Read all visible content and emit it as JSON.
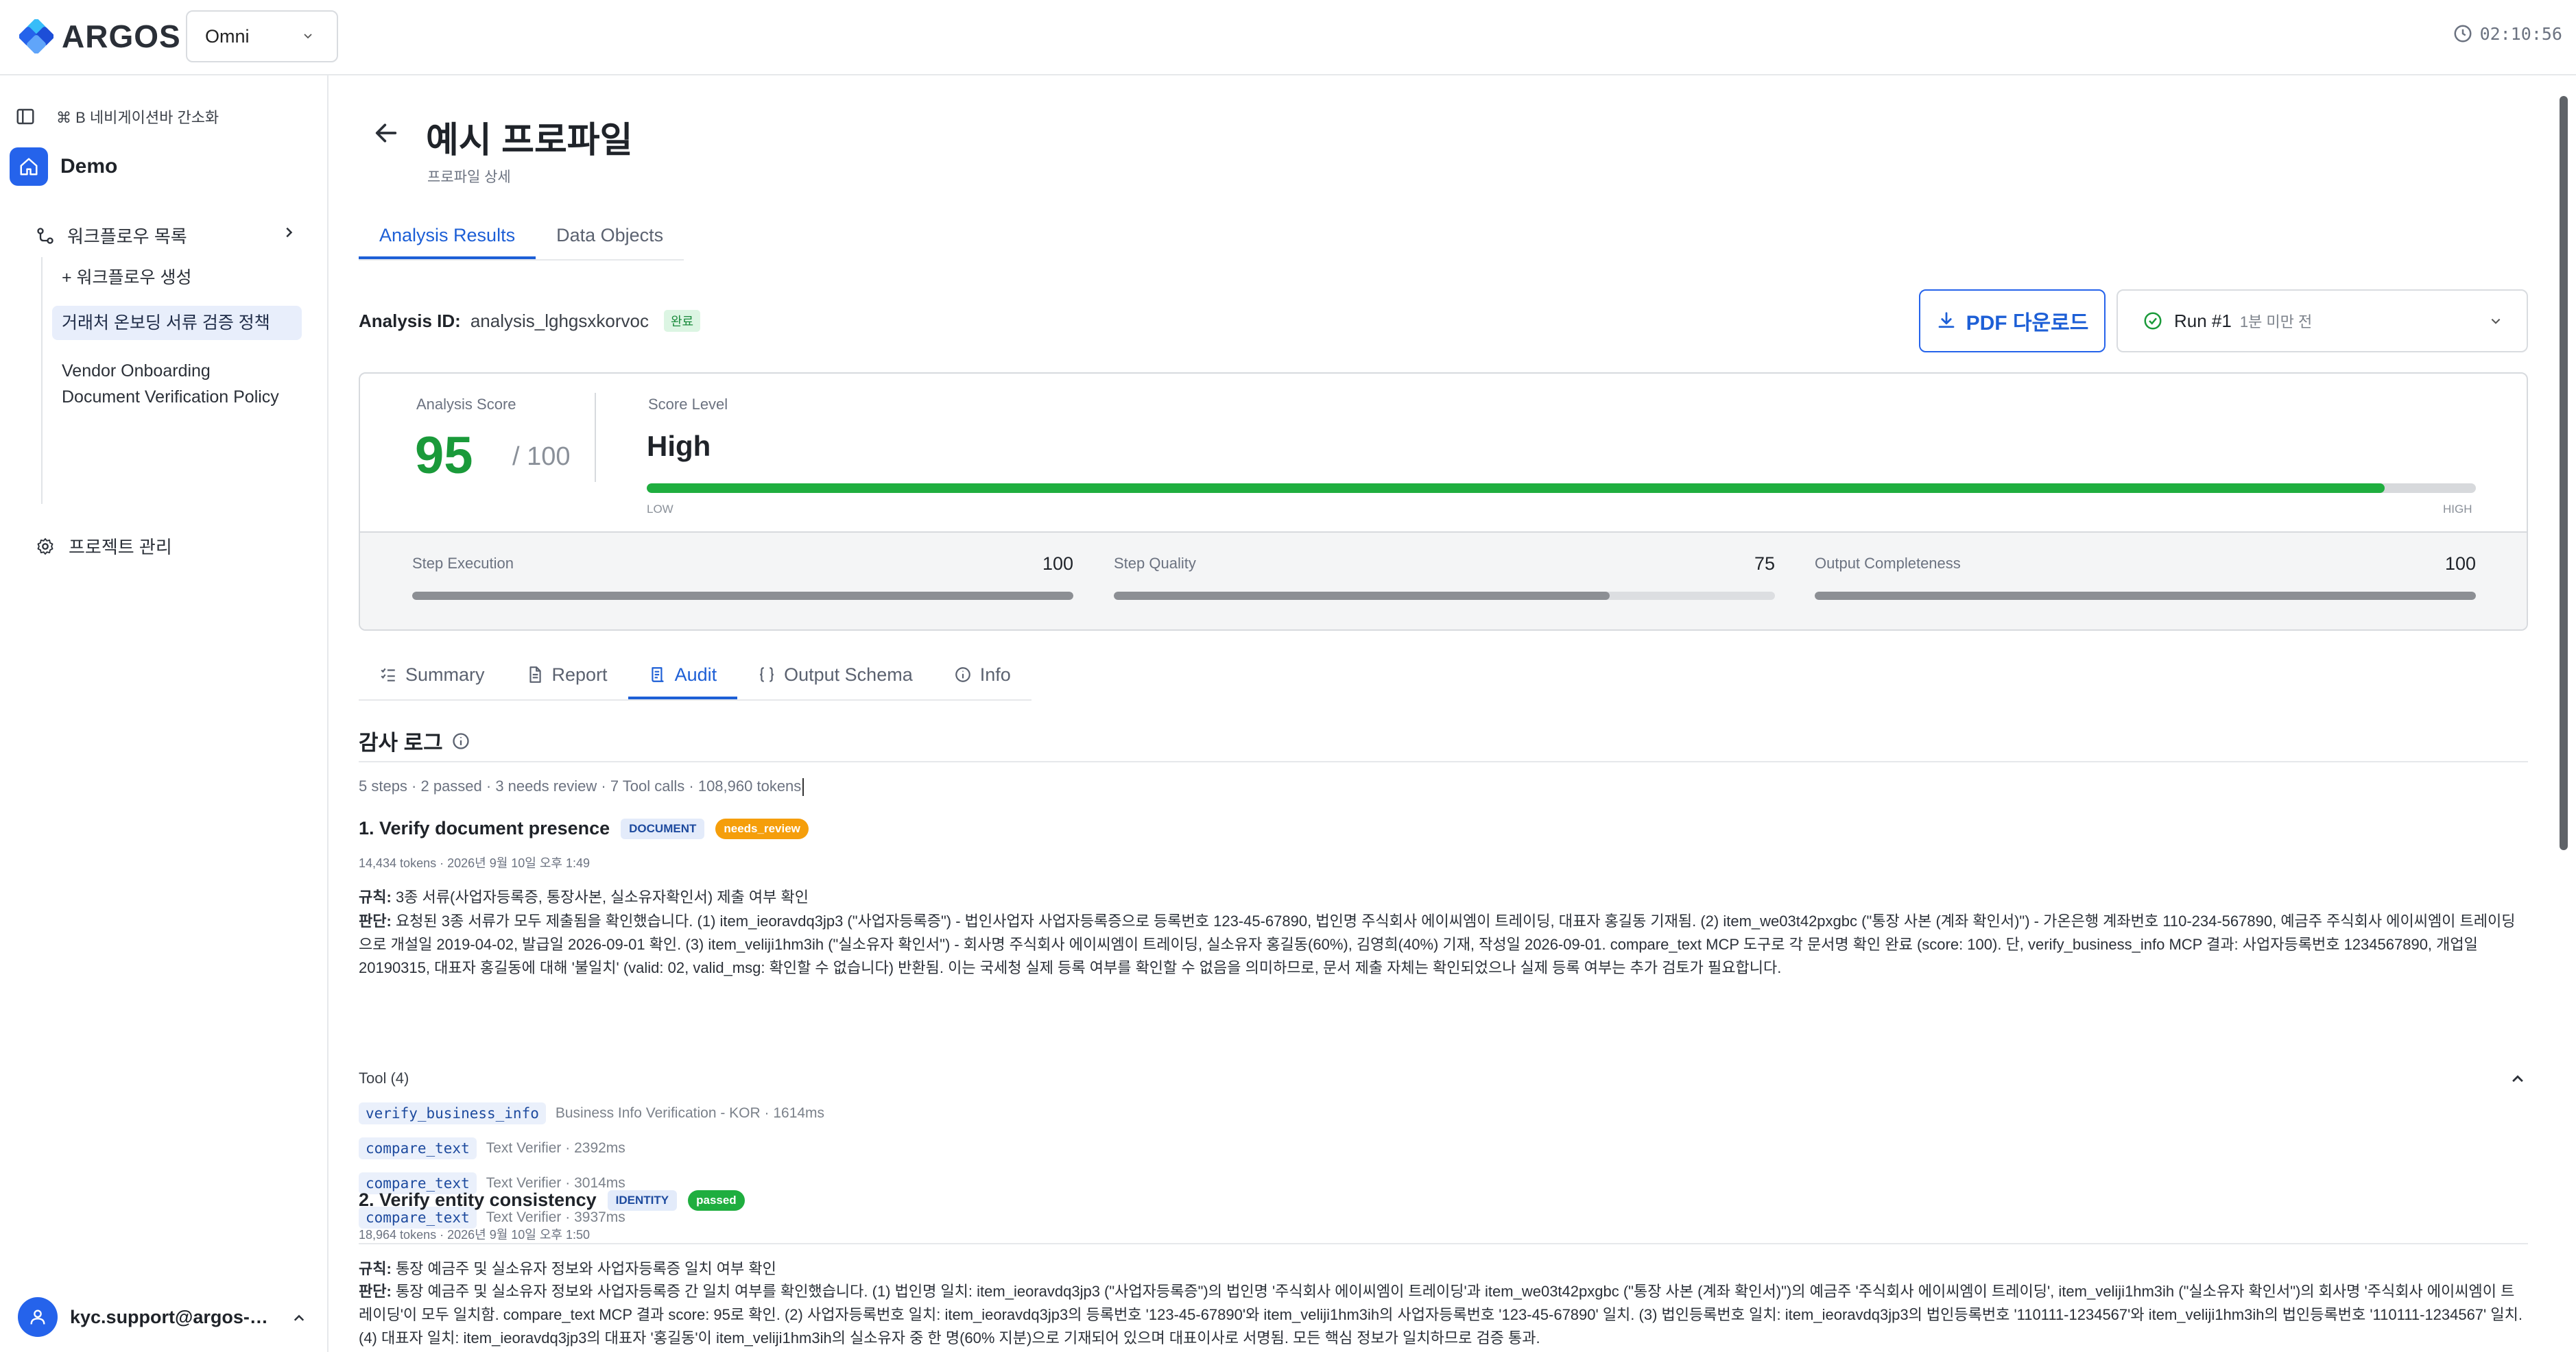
{
  "app": {
    "logo_text": "ARGOS",
    "workspace": "Omni",
    "clock": "02:10:56"
  },
  "sidebar": {
    "collapse_hint": "⌘ B 네비게이션바 간소화",
    "project": "Demo",
    "workflow_list": "워크플로우 목록",
    "create_workflow": "+ 워크플로우 생성",
    "workflows": [
      "거래처 온보딩 서류 검증 정책",
      "Vendor Onboarding Document Verification Policy"
    ],
    "project_manage": "프로젝트 관리",
    "user_email": "kyc.support@argos-s..."
  },
  "page": {
    "title": "예시 프로파일",
    "subtitle": "프로파일 상세",
    "tabs": [
      "Analysis Results",
      "Data Objects"
    ]
  },
  "analysis": {
    "id_label": "Analysis ID:",
    "id_value": "analysis_lghgsxkorvoc",
    "status": "완료",
    "pdf_button": "PDF 다운로드",
    "run_label": "Run #1",
    "run_time": "1분 미만 전"
  },
  "score": {
    "label": "Analysis Score",
    "value": "95",
    "max": "/ 100",
    "level_label": "Score Level",
    "level": "High",
    "level_fraction": 0.95,
    "low": "LOW",
    "high": "HIGH",
    "metrics": [
      {
        "name": "Step Execution",
        "value": "100",
        "fraction": 1.0
      },
      {
        "name": "Step Quality",
        "value": "75",
        "fraction": 0.75
      },
      {
        "name": "Output Completeness",
        "value": "100",
        "fraction": 1.0
      }
    ]
  },
  "result_tabs": [
    "Summary",
    "Report",
    "Audit",
    "Output Schema",
    "Info"
  ],
  "audit": {
    "title": "감사 로그",
    "meta": "5 steps · 2 passed · 3 needs review · 7 Tool calls · 108,960 tokens",
    "steps": [
      {
        "title": "1. Verify document presence",
        "tag": "DOCUMENT",
        "status": "needs_review",
        "meta": "14,434 tokens · 2026년 9월 10일 오후 1:49",
        "rule_label": "규칙:",
        "rule": "3종 서류(사업자등록증, 통장사본, 실소유자확인서) 제출 여부 확인",
        "judge_label": "판단:",
        "judge": "요청된 3종 서류가 모두 제출됨을 확인했습니다. (1) item_ieoravdq3jp3 (\"사업자등록증\") - 법인사업자 사업자등록증으로 등록번호 123-45-67890, 법인명 주식회사 에이씨엠이 트레이딩, 대표자 홍길동 기재됨. (2) item_we03t42pxgbc (\"통장 사본 (계좌 확인서)\") - 가온은행 계좌번호 110-234-567890, 예금주 주식회사 에이씨엠이 트레이딩으로 개설일 2019-04-02, 발급일 2026-09-01 확인. (3) item_veliji1hm3ih (\"실소유자 확인서\") - 회사명 주식회사 에이씨엠이 트레이딩, 실소유자 홍길동(60%), 김영희(40%) 기재, 작성일 2026-09-01. compare_text MCP 도구로 각 문서명 확인 완료 (score: 100). 단, verify_business_info MCP 결과: 사업자등록번호 1234567890, 개업일 20190315, 대표자 홍길동에 대해 '불일치' (valid: 02, valid_msg: 확인할 수 없습니다) 반환됨. 이는 국세청 실제 등록 여부를 확인할 수 없음을 의미하므로, 문서 제출 자체는 확인되었으나 실제 등록 여부는 추가 검토가 필요합니다.",
        "tool_head": "Tool (4)",
        "tools": [
          {
            "name": "verify_business_info",
            "desc": "Business Info Verification - KOR · 1614ms"
          },
          {
            "name": "compare_text",
            "desc": "Text Verifier · 2392ms"
          },
          {
            "name": "compare_text",
            "desc": "Text Verifier · 3014ms"
          },
          {
            "name": "compare_text",
            "desc": "Text Verifier · 3937ms"
          }
        ]
      },
      {
        "title": "2. Verify entity consistency",
        "tag": "IDENTITY",
        "status": "passed",
        "meta": "18,964 tokens · 2026년 9월 10일 오후 1:50",
        "rule_label": "규칙:",
        "rule": "통장 예금주 및 실소유자 정보와 사업자등록증 일치 여부 확인",
        "judge_label": "판단:",
        "judge": "통장 예금주 및 실소유자 정보와 사업자등록증 간 일치 여부를 확인했습니다. (1) 법인명 일치: item_ieoravdq3jp3 (\"사업자등록증\")의 법인명 '주식회사 에이씨엠이 트레이딩'과 item_we03t42pxgbc (\"통장 사본 (계좌 확인서)\")의 예금주 '주식회사 에이씨엠이 트레이딩', item_veliji1hm3ih (\"실소유자 확인서\")의 회사명 '주식회사 에이씨엠이 트레이딩'이 모두 일치함. compare_text MCP 결과 score: 95로 확인. (2) 사업자등록번호 일치: item_ieoravdq3jp3의 등록번호 '123-45-67890'와 item_veliji1hm3ih의 사업자등록번호 '123-45-67890' 일치. (3) 법인등록번호 일치: item_ieoravdq3jp3의 법인등록번호 '110111-1234567'와 item_veliji1hm3ih의 법인등록번호 '110111-1234567' 일치. (4) 대표자 일치: item_ieoravdq3jp3의 대표자 '홍길동'이 item_veliji1hm3ih의 실소유자 중 한 명(60% 지분)으로 기재되어 있으며 대표이사로 서명됨. 모든 핵심 정보가 일치하므로 검증 통과."
      }
    ]
  },
  "colors": {
    "accent": "#2563eb",
    "score_green": "#1a9a3a",
    "review_orange": "#f59e0b"
  }
}
